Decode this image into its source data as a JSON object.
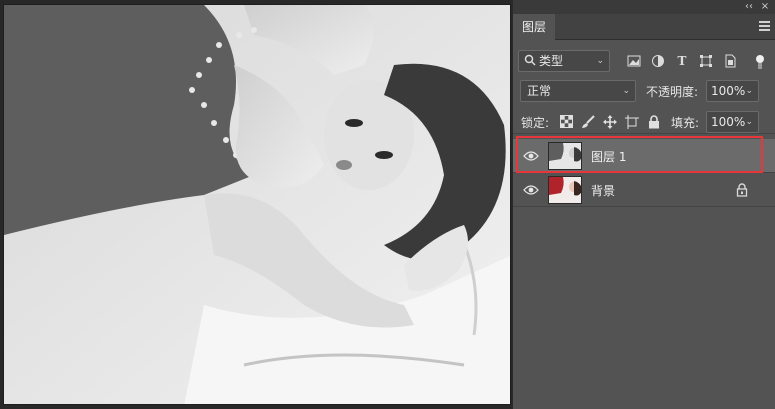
{
  "panel": {
    "collapse_glyph": "‹‹",
    "close_glyph": "×",
    "tab_label": "图层",
    "filter": {
      "kind_label": "类型",
      "icons": [
        "image-filter-icon",
        "adjustment-filter-icon",
        "type-filter-icon",
        "shape-filter-icon",
        "smart-object-filter-icon",
        "filter-toggle-icon"
      ]
    },
    "blend_mode": "正常",
    "opacity_label": "不透明度:",
    "opacity_value": "100%",
    "lock_label": "锁定:",
    "lock_icons": [
      "lock-transparent-pixels-icon",
      "lock-image-pixels-icon",
      "lock-position-icon",
      "lock-artboard-icon",
      "lock-all-icon"
    ],
    "fill_label": "填充:",
    "fill_value": "100%"
  },
  "layers": [
    {
      "name": "图层 1",
      "visible": true,
      "selected": true,
      "locked": false,
      "thumb": "grayscale-photo"
    },
    {
      "name": "背景",
      "visible": true,
      "selected": false,
      "locked": true,
      "thumb": "color-photo"
    }
  ],
  "colors": {
    "panel_bg": "#535353",
    "selected_bg": "#6b6b6b",
    "highlight": "#e8373a"
  }
}
